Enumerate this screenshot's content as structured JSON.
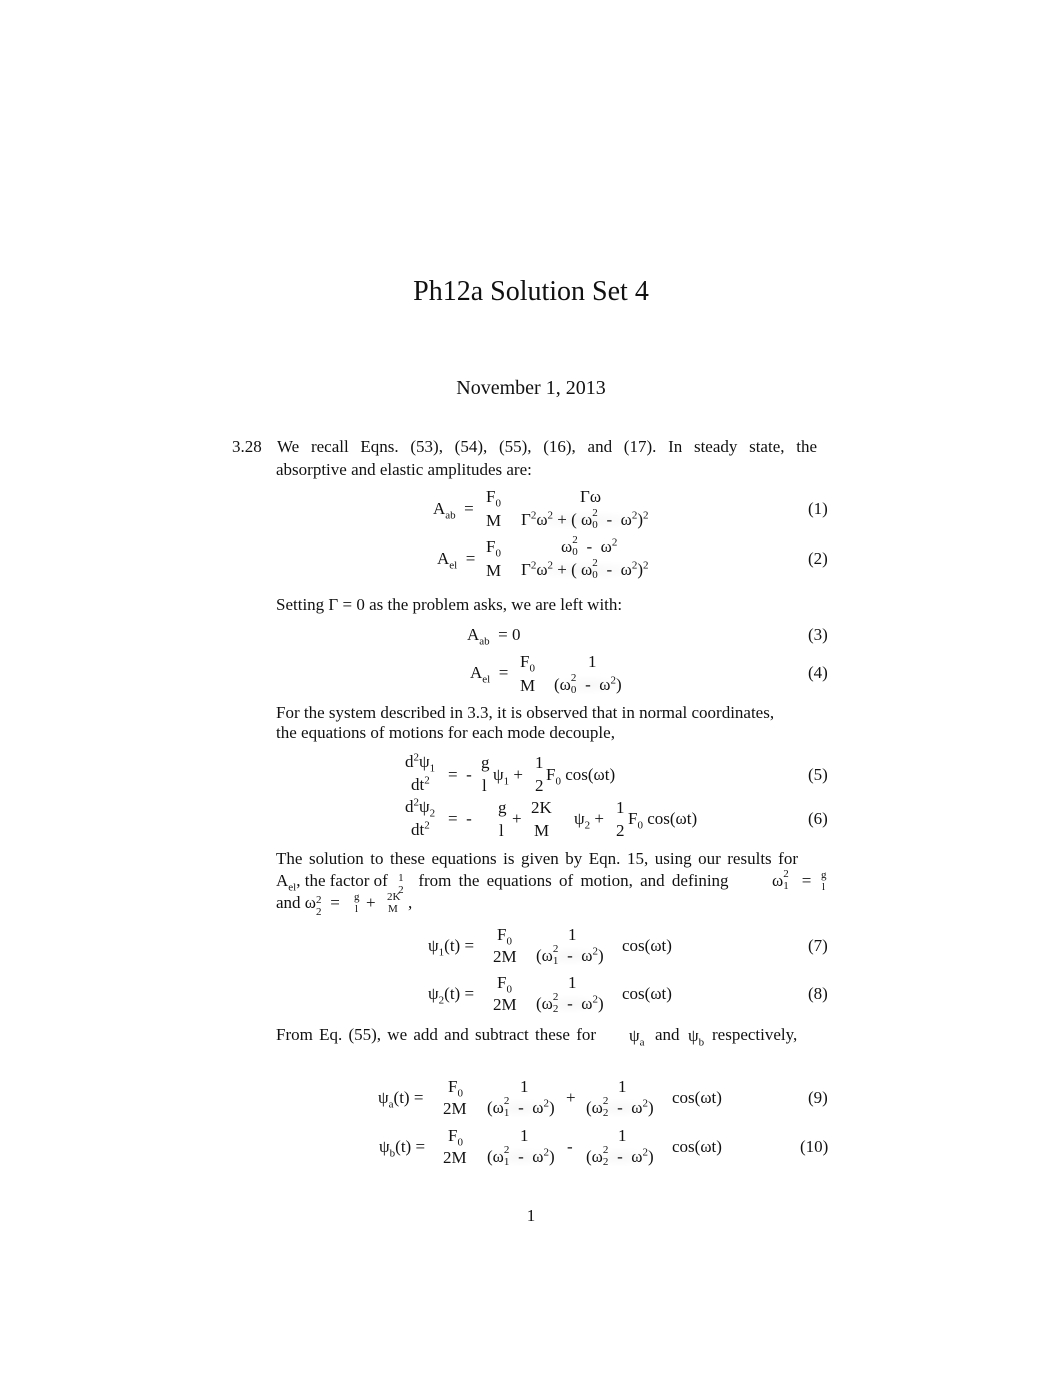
{
  "document": {
    "title": "Ph12a Solution Set 4",
    "date": "November 1, 2013",
    "page_number": "1"
  },
  "problem": {
    "number": "3.28",
    "intro_line1": "We recall Eqns.  (53), (54), (55), (16), and (17).  In steady state, the",
    "intro_line2": "absorptive and elastic amplitudes are:",
    "setting_text": "Setting Γ = 0 as the problem asks, we are left with:",
    "system_line1": "For the system described in 3.3, it is observed that in normal coordinates,",
    "system_line2": "the equations of motions for each mode decouple,",
    "solution_line1": "The solution to these equations is given by Eqn. 15, using our results for",
    "solution_line2_a": ", the factor of",
    "solution_line2_b": "from the equations of motion, and defining",
    "solution_line3_a": "and",
    "from_eq_a": "From Eq. (55), we add and subtract these for",
    "from_eq_and": "and",
    "from_eq_b": "respectively,"
  },
  "equations": {
    "eq1": {
      "lhs": "A",
      "lhs_sub": "ab",
      "num_f": "F",
      "den_f": "M",
      "num": "Γω",
      "den": "Γ²ω² + ( ω₀² -  ω²)²",
      "number": "(1)"
    },
    "eq2": {
      "lhs": "A",
      "lhs_sub": "el",
      "num_f": "F",
      "den_f": "M",
      "num": "ω₀² -  ω²",
      "den": "Γ²ω² + ( ω₀² -  ω²)²",
      "number": "(2)"
    },
    "eq3": {
      "lhs": "A",
      "lhs_sub": "ab",
      "rhs": "= 0",
      "number": "(3)"
    },
    "eq4": {
      "lhs": "A",
      "lhs_sub": "el",
      "num_f": "F",
      "den_f": "M",
      "num": "1",
      "den": "(ω₀² -  ω²)",
      "number": "(4)"
    },
    "eq5": {
      "number": "(5)"
    },
    "eq6": {
      "number": "(6)"
    },
    "eq7": {
      "number": "(7)"
    },
    "eq8": {
      "number": "(8)"
    },
    "eq9": {
      "number": "(9)"
    },
    "eq10": {
      "number": "(10)"
    }
  }
}
